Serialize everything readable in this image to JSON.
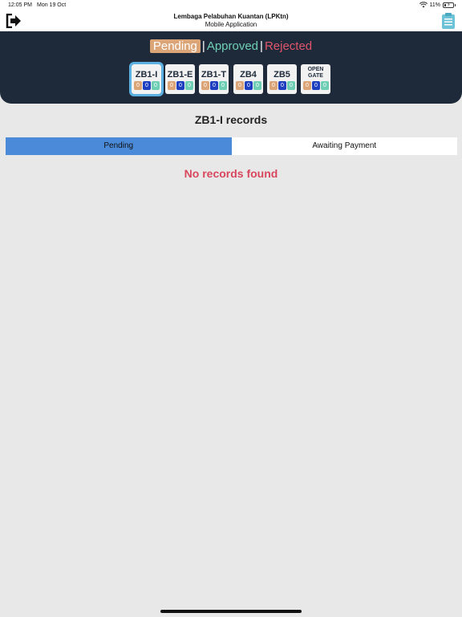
{
  "status_bar": {
    "time": "12:05 PM",
    "date": "Mon 19 Oct",
    "battery": "11%"
  },
  "header": {
    "title_line1": "Lembaga Pelabuhan Kuantan (LPKtn)",
    "title_line2": "Mobile Application"
  },
  "status_tabs": {
    "pending": "Pending",
    "approved": "Approved",
    "rejected": "Rejected",
    "separator": "|"
  },
  "zones": [
    {
      "label": "ZB1-I",
      "pending": "0",
      "approved": "0",
      "rejected": "0"
    },
    {
      "label": "ZB1-E",
      "pending": "0",
      "approved": "0",
      "rejected": "0"
    },
    {
      "label": "ZB1-T",
      "pending": "0",
      "approved": "0",
      "rejected": "0"
    },
    {
      "label": "ZB4",
      "pending": "0",
      "approved": "0",
      "rejected": "0"
    },
    {
      "label": "ZB5",
      "pending": "0",
      "approved": "0",
      "rejected": "0"
    },
    {
      "label": "OPEN GATE",
      "pending": "0",
      "approved": "0",
      "rejected": "0"
    }
  ],
  "records": {
    "title": "ZB1-I records",
    "subtabs": [
      "Pending",
      "Awaiting Payment"
    ],
    "empty_message": "No records found"
  },
  "colors": {
    "header_bg": "#1e2a3a",
    "pending": "#dca578",
    "approved": "#6fcfb4",
    "rejected": "#e0556a",
    "active_tab": "#4a8ad8"
  }
}
